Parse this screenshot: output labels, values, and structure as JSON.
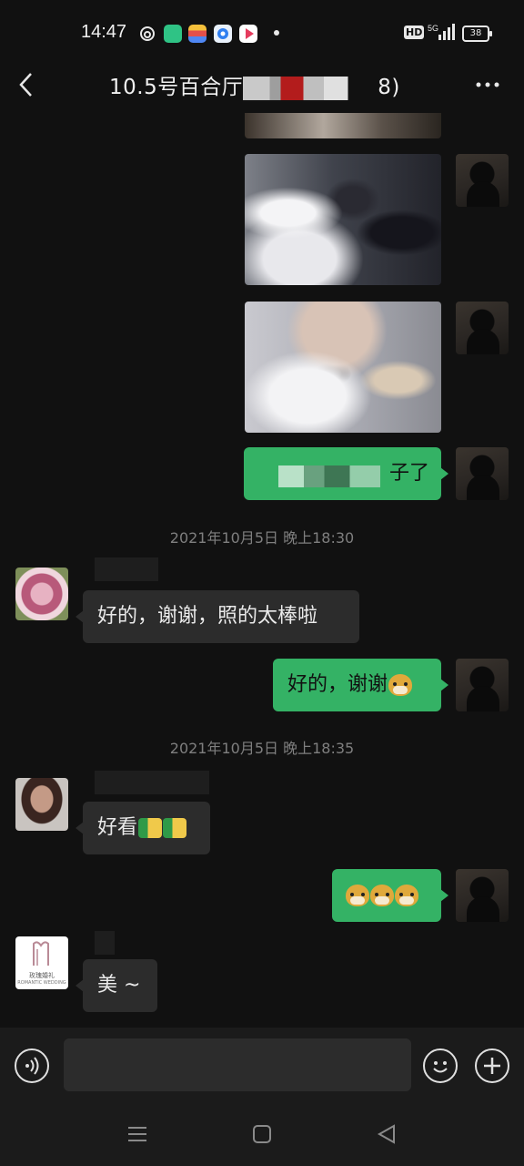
{
  "status_bar": {
    "time": "14:47",
    "network": "5G",
    "hd": "HD",
    "battery": "38"
  },
  "header": {
    "title_visible_start": "10.5号百合厅",
    "title_visible_end": "8)",
    "back_icon": "chevron-left-icon",
    "more_icon": "more-dots-icon"
  },
  "messages": [
    {
      "type": "image",
      "direction": "out"
    },
    {
      "type": "image",
      "direction": "out"
    },
    {
      "type": "text",
      "direction": "out",
      "text_visible": "子了"
    },
    {
      "type": "timestamp",
      "text": "2021年10月5日 晚上18:30"
    },
    {
      "type": "text",
      "direction": "in",
      "text": "好的，谢谢，照的太棒啦"
    },
    {
      "type": "text",
      "direction": "out",
      "text": "好的，谢谢",
      "emoji": [
        "doge"
      ]
    },
    {
      "type": "timestamp",
      "text": "2021年10月5日 晚上18:35"
    },
    {
      "type": "text",
      "direction": "in",
      "text": "好看",
      "emoji": [
        "thumbs-up",
        "thumbs-up"
      ]
    },
    {
      "type": "text",
      "direction": "out",
      "text": "",
      "emoji": [
        "doge",
        "doge",
        "doge"
      ]
    },
    {
      "type": "text",
      "direction": "in",
      "text": "美 ~"
    }
  ],
  "avatars": {
    "logo_line1": "玫瑰婚礼",
    "logo_line2": "ROMANTIC WEDDING"
  },
  "colors": {
    "outgoing_bubble": "#34b265",
    "incoming_bubble": "#2c2c2c",
    "background": "#111111"
  }
}
